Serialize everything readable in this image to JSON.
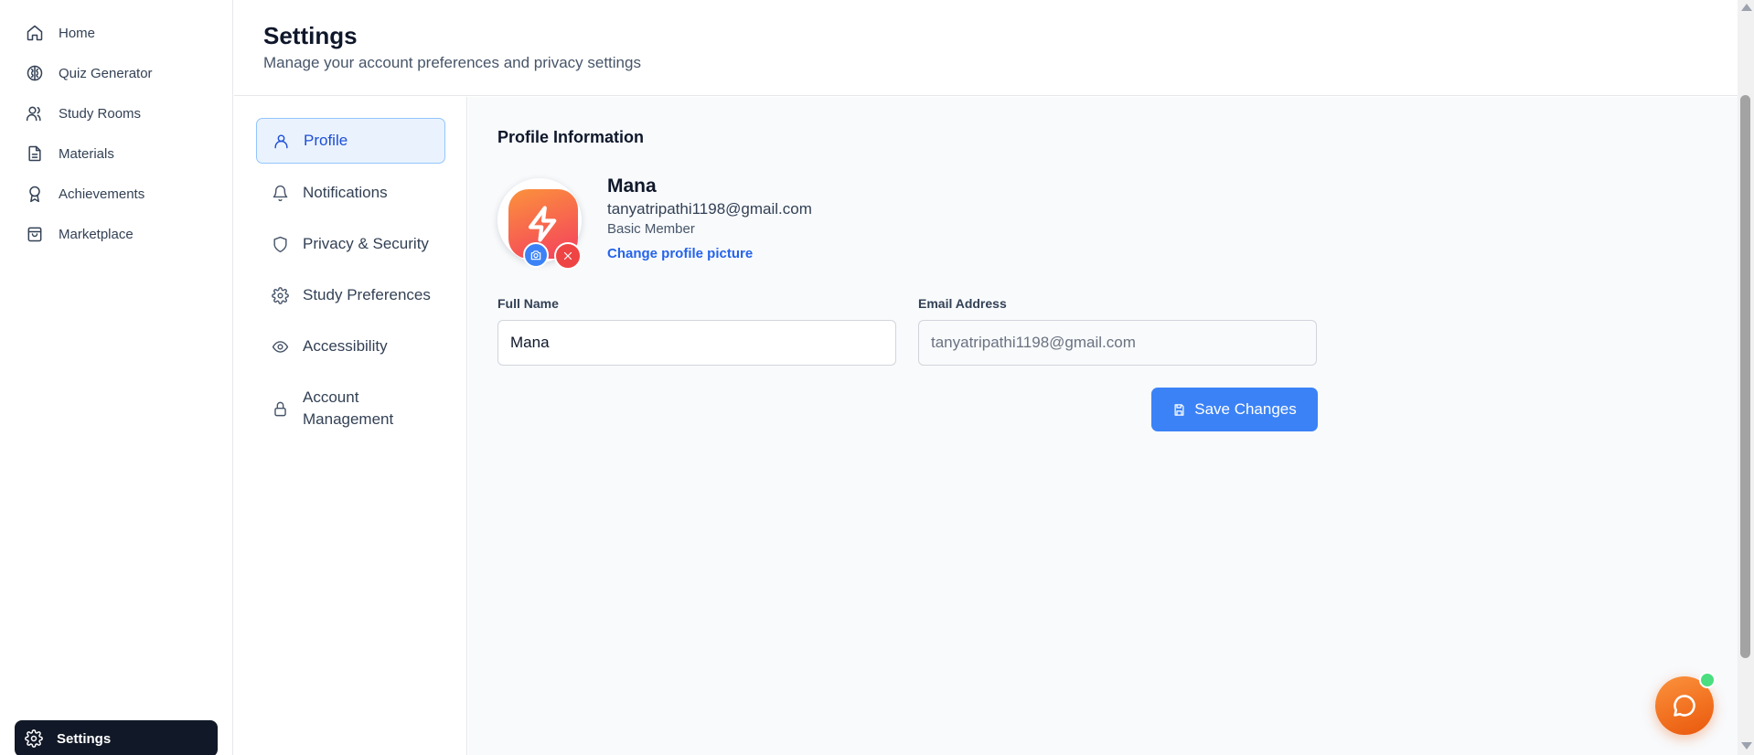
{
  "sidebar": {
    "items": [
      {
        "label": "Home",
        "icon": "home-icon"
      },
      {
        "label": "Quiz Generator",
        "icon": "brain-icon"
      },
      {
        "label": "Study Rooms",
        "icon": "users-icon"
      },
      {
        "label": "Materials",
        "icon": "document-icon"
      },
      {
        "label": "Achievements",
        "icon": "award-icon"
      },
      {
        "label": "Marketplace",
        "icon": "shopping-bag-icon"
      }
    ],
    "settings_label": "Settings"
  },
  "header": {
    "title": "Settings",
    "subtitle": "Manage your account preferences and privacy settings"
  },
  "settings_menu": {
    "items": [
      {
        "label": "Profile",
        "icon": "user-icon",
        "active": true
      },
      {
        "label": "Notifications",
        "icon": "bell-icon"
      },
      {
        "label": "Privacy & Security",
        "icon": "shield-icon"
      },
      {
        "label": "Study Preferences",
        "icon": "gear-icon"
      },
      {
        "label": "Accessibility",
        "icon": "eye-icon"
      },
      {
        "label": "Account Management",
        "icon": "lock-icon"
      }
    ]
  },
  "profile": {
    "section_title": "Profile Information",
    "name": "Mana",
    "email": "tanyatripathi1198@gmail.com",
    "membership": "Basic Member",
    "change_picture_label": "Change profile picture",
    "full_name_label": "Full Name",
    "full_name_value": "Mana",
    "email_label": "Email Address",
    "email_value": "tanyatripathi1198@gmail.com",
    "save_label": "Save Changes"
  },
  "colors": {
    "accent": "#3b82f6",
    "active_nav_bg": "#111827",
    "danger": "#ef4444",
    "chat_button": "#f97316",
    "online": "#4ade80"
  }
}
